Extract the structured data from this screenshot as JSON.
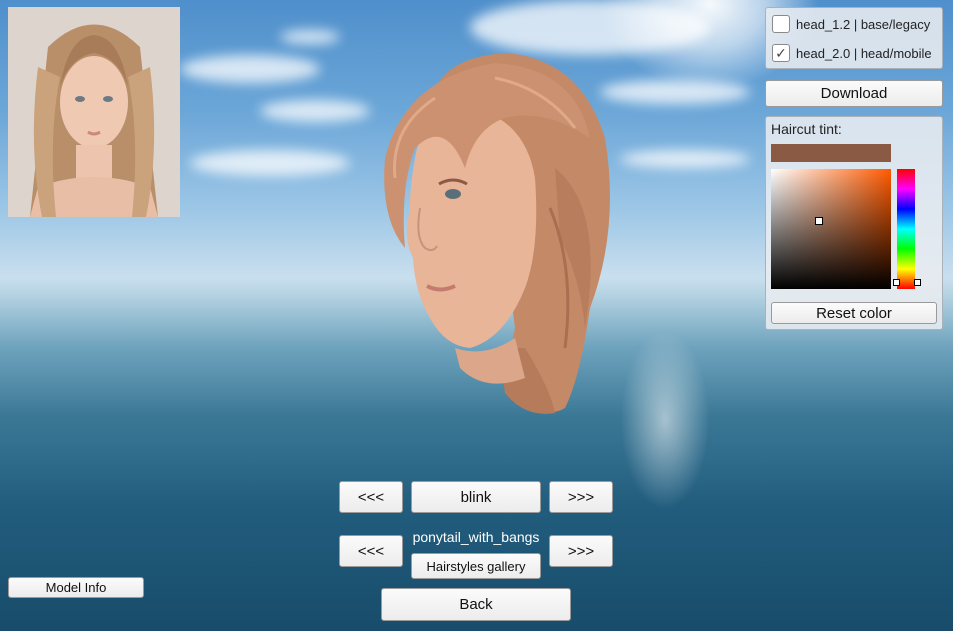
{
  "portrait": {
    "alt": "source photo"
  },
  "options": [
    {
      "label": "head_1.2 | base/legacy",
      "checked": false
    },
    {
      "label": "head_2.0 | head/mobile",
      "checked": true
    }
  ],
  "download_label": "Download",
  "tint": {
    "label": "Haircut tint:",
    "color": "#8b5a45",
    "reset_label": "Reset color"
  },
  "blendshape": {
    "prev_label": "<<<",
    "name": "blink",
    "next_label": ">>>"
  },
  "haircut": {
    "prev_label": "<<<",
    "name": "ponytail_with_bangs",
    "gallery_label": "Hairstyles gallery",
    "next_label": ">>>"
  },
  "back_label": "Back",
  "model_info_label": "Model Info",
  "colors": {
    "hair": "#c98e6c",
    "skin": "#e9b99c"
  }
}
